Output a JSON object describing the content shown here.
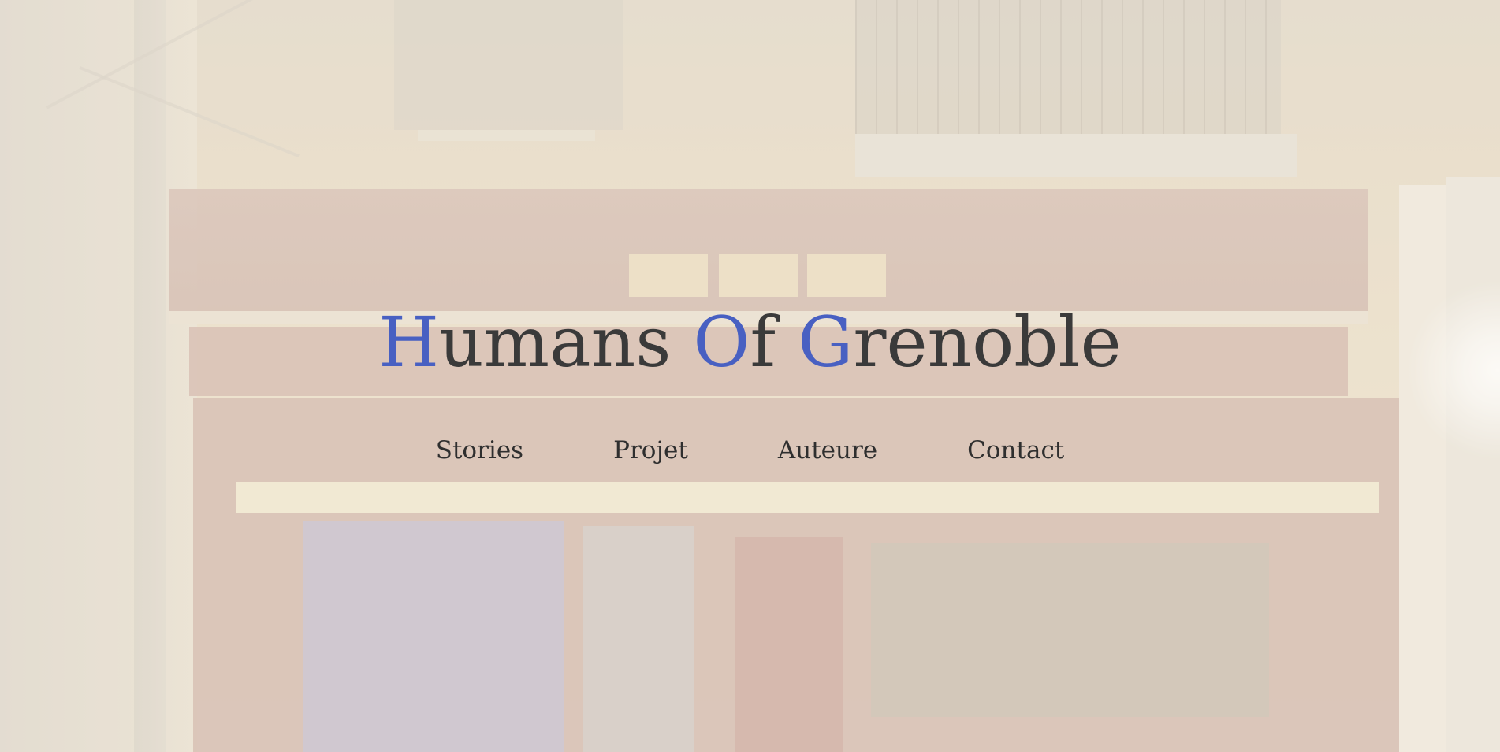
{
  "site": {
    "title_parts": [
      {
        "text": "H",
        "accent": true
      },
      {
        "text": "umans ",
        "accent": false
      },
      {
        "text": "O",
        "accent": true
      },
      {
        "text": "f ",
        "accent": false
      },
      {
        "text": "G",
        "accent": true
      },
      {
        "text": "renoble",
        "accent": false
      }
    ],
    "accent_color": "#4860c2",
    "text_color": "#3a3a3a"
  },
  "nav": {
    "items": [
      {
        "label": "Stories"
      },
      {
        "label": "Projet"
      },
      {
        "label": "Auteure"
      },
      {
        "label": "Contact"
      }
    ]
  },
  "background": {
    "subject": "storefront-photo"
  }
}
